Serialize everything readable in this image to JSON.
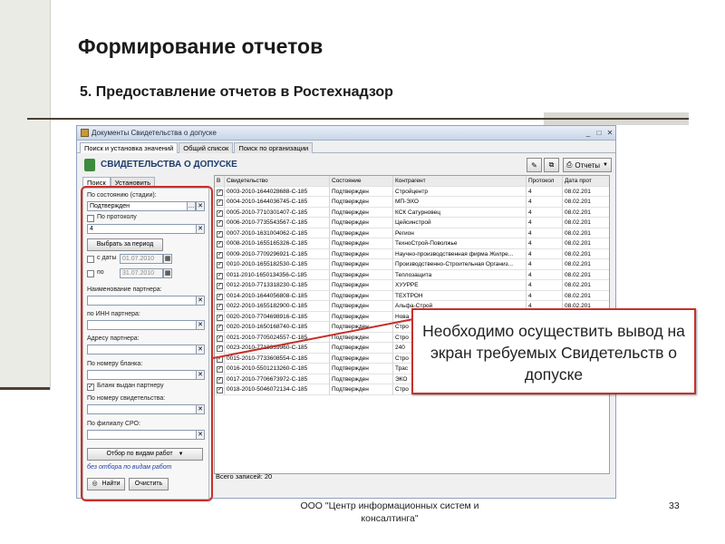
{
  "slide": {
    "title": "Формирование отчетов",
    "subtitle": "5. Предоставление отчетов в Ростехнадзор",
    "callout": "Необходимо осуществить вывод на экран требуемых Свидетельств о допуске",
    "footer": "ООО \"Центр информационных систем и консалтинга\"",
    "page_number": "33"
  },
  "window": {
    "title": "Документы Свидетельства о допуске",
    "tabs": [
      "Поиск и установка значений",
      "Общий список",
      "Поиск по организации"
    ],
    "header": "СВИДЕТЕЛЬСТВА О ДОПУСКЕ",
    "reports_button": "Отчеты",
    "panel_tabs": [
      "Поиск",
      "Установить"
    ],
    "filter": {
      "state_label": "По состоянию (стадии):",
      "state_value": "Подтвержден",
      "protocol_label": "По протоколу",
      "protocol_value": "4",
      "period_button": "Выбрать за период",
      "from_label": "с даты",
      "from_value": "01.07.2010",
      "to_label": "по",
      "to_value": "31.07.2010",
      "partner_name_label": "Наименование партнера:",
      "partner_inn_label": "по ИНН партнера:",
      "partner_address_label": "Адресу партнера:",
      "form_number_label": "По номеру бланка:",
      "form_issued_label": "Бланк выдан партнеру",
      "cert_number_label": "По номеру свидетельства:",
      "sro_branch_label": "По филиалу СРО:",
      "work_types_button": "Отбор по видам работ",
      "no_work_filter": "без отбора по видам работ",
      "find_button": "Найти",
      "clear_button": "Очистить"
    },
    "table": {
      "columns": [
        "В",
        "Свидетельство",
        "Состояние",
        "Контрагент",
        "Протокол",
        "Дата прот"
      ],
      "rows": [
        [
          "0003-2010-1644028688-С-185",
          "Подтвержден",
          "Стройцентр",
          "4",
          "08.02.201"
        ],
        [
          "0004-2010-1644036745-С-185",
          "Подтвержден",
          "МП-ЭХО",
          "4",
          "08.02.201"
        ],
        [
          "0005-2010-7710301407-С-185",
          "Подтвержден",
          "КСК Сатурновец",
          "4",
          "08.02.201"
        ],
        [
          "0006-2010-7735543567-С-185",
          "Подтвержден",
          "Цейсинстрой",
          "4",
          "08.02.201"
        ],
        [
          "0007-2010-1631004062-С-185",
          "Подтвержден",
          "Регион",
          "4",
          "08.02.201"
        ],
        [
          "0008-2010-1655165326-С-185",
          "Подтвержден",
          "ТехноСтрой-Поволжье",
          "4",
          "08.02.201"
        ],
        [
          "0009-2010-7709296921-С-185",
          "Подтвержден",
          "Научно-производственная фирма Жилре...",
          "4",
          "08.02.201"
        ],
        [
          "0010-2010-1655182530-С-185",
          "Подтвержден",
          "Производственно-Строительная Организ...",
          "4",
          "08.02.201"
        ],
        [
          "0011-2010-1650134356-С-185",
          "Подтвержден",
          "Теплозащита",
          "4",
          "08.02.201"
        ],
        [
          "0012-2010-7713318230-С-185",
          "Подтвержден",
          "ХУУРРЕ",
          "4",
          "08.02.201"
        ],
        [
          "0014-2010-1644056808-С-185",
          "Подтвержден",
          "ТЕХТРОН",
          "4",
          "08.02.201"
        ],
        [
          "0022-2010-1655182900-С-185",
          "Подтвержден",
          "Альфа-Строй",
          "4",
          "08.02.201"
        ],
        [
          "0020-2010-7704698916-С-185",
          "Подтвержден",
          "Нова",
          "",
          ""
        ],
        [
          "0020-2010-1650168740-С-185",
          "Подтвержден",
          "Стро",
          "",
          ""
        ],
        [
          "0021-2010-7705024557-С-185",
          "Подтвержден",
          "Стро",
          "",
          ""
        ],
        [
          "0023-2010-7718339960-С-185",
          "Подтвержден",
          "240",
          "",
          ""
        ],
        [
          "0015-2010-7733608554-С-185",
          "Подтвержден",
          "Стро",
          "",
          ""
        ],
        [
          "0016-2010-5501213260-С-185",
          "Подтвержден",
          "Трас",
          "",
          ""
        ],
        [
          "0017-2010-7706673972-С-185",
          "Подтвержден",
          "ЭКО",
          "",
          ""
        ],
        [
          "0018-2010-5046072134-С-185",
          "Подтвержден",
          "Стро",
          "",
          ""
        ]
      ]
    },
    "records_total": "Всего записей: 20"
  },
  "colors": {
    "accent_red": "#c8302b",
    "header_blue": "#1d3c6e",
    "rule": "#4a4033"
  }
}
